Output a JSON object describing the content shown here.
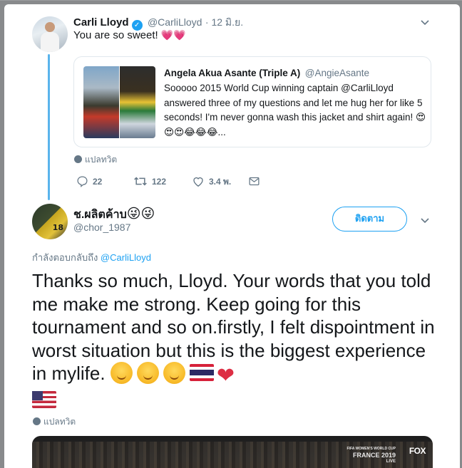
{
  "tweet1": {
    "author_name": "Carli Lloyd",
    "handle": "@CarliLloyd",
    "date": "· 12 มิ.ย.",
    "text": "You are so sweet!",
    "text_emoji": "💗💗",
    "quote": {
      "author_name": "Angela Akua Asante (Triple A)",
      "handle": "@AngieAsante",
      "text": "Sooooo 2015 World Cup winning captain @CarliLloyd answered three of my questions and let me hug her for like 5 seconds! I'm never gonna wash this jacket and shirt again! 😍😍😍😂😂😂..."
    },
    "translate_label": "แปลทวิต",
    "actions": {
      "replies": "22",
      "retweets": "122",
      "likes": "3.4 พ."
    }
  },
  "tweet2": {
    "author_name": "ช.ผลิตค้าบ",
    "author_emoji": "😜😜",
    "handle": "@chor_1987",
    "follow_label": "ติดตาม",
    "replying_prefix": "กำลังตอบกลับถึง",
    "replying_handle": "@CarliLloyd",
    "text": "Thanks so much, Lloyd. Your words that you told me make me strong. Keep going for this tournament and so on.firstly, I felt dispointment in worst situation but this is the biggest experience in mylife.",
    "translate_label": "แปลทวิต",
    "video_overlay": {
      "event_label_line1": "FIFA WOMEN'S WORLD CUP",
      "event_label_line2": "FRANCE 2019",
      "live_label": "LIVE",
      "network": "FOX"
    },
    "avatar_number": "18"
  },
  "colors": {
    "accent": "#1da1f2",
    "muted": "#657786",
    "thread_line": "#5ab4ec",
    "heart": "#e8375a"
  },
  "icons": [
    "verified-badge-icon",
    "chevron-down-icon",
    "reply-icon",
    "retweet-icon",
    "like-icon",
    "share-mail-icon",
    "globe-icon"
  ]
}
